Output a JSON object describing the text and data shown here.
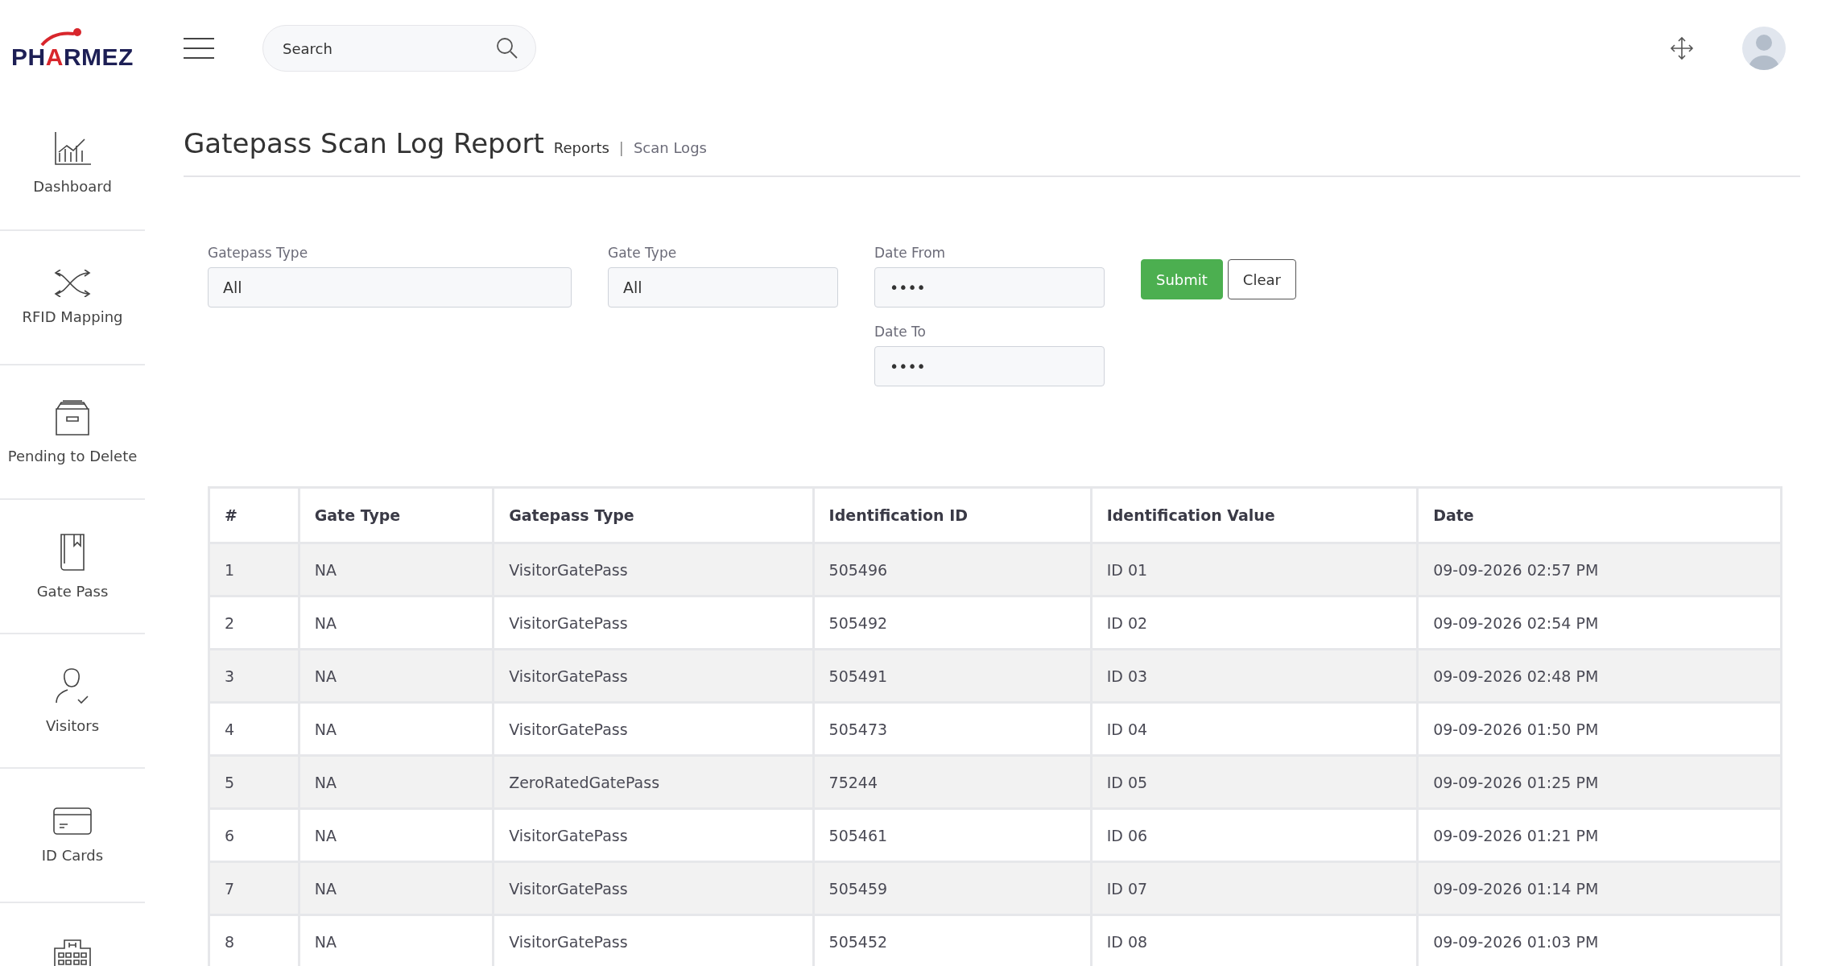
{
  "header": {
    "logo": "PHARMEZ",
    "search": {
      "placeholder": "Search"
    }
  },
  "sidebar": {
    "items": [
      {
        "label": "Dashboard",
        "selected": false
      },
      {
        "label": "RFID Mapping",
        "selected": false
      },
      {
        "label": "Pending to Delete",
        "selected": false
      },
      {
        "label": "Gate Pass",
        "selected": false
      },
      {
        "label": "Visitors",
        "selected": false
      },
      {
        "label": "ID Cards",
        "selected": false
      }
    ]
  },
  "page": {
    "title": "Gatepass Scan Log Report",
    "breadcrumbs": [
      "Reports",
      "Scan Logs"
    ],
    "separator": "|"
  },
  "filters": {
    "fields": [
      {
        "label": "Gatepass Type",
        "value": "All"
      },
      {
        "label": "Gate Type",
        "value": "All"
      },
      {
        "label": "Date From",
        "value": "••••"
      },
      {
        "label": "Date To",
        "value": "••••"
      }
    ],
    "buttons": [
      {
        "label": "Submit",
        "kind": "primary"
      },
      {
        "label": "Clear",
        "kind": "outline"
      }
    ]
  },
  "table": {
    "columns": [
      "#",
      "Gate Type",
      "Gatepass Type",
      "Identification ID",
      "Identification Value",
      "Date"
    ],
    "rows": [
      [
        "1",
        "NA",
        "VisitorGatePass",
        "505496",
        "ID 01",
        "09-09-2026 02:57 PM"
      ],
      [
        "2",
        "NA",
        "VisitorGatePass",
        "505492",
        "ID 02",
        "09-09-2026 02:54 PM"
      ],
      [
        "3",
        "NA",
        "VisitorGatePass",
        "505491",
        "ID 03",
        "09-09-2026 02:48 PM"
      ],
      [
        "4",
        "NA",
        "VisitorGatePass",
        "505473",
        "ID 04",
        "09-09-2026 01:50 PM"
      ],
      [
        "5",
        "NA",
        "ZeroRatedGatePass",
        "75244",
        "ID 05",
        "09-09-2026 01:25 PM"
      ],
      [
        "6",
        "NA",
        "VisitorGatePass",
        "505461",
        "ID 06",
        "09-09-2026 01:21 PM"
      ],
      [
        "7",
        "NA",
        "VisitorGatePass",
        "505459",
        "ID 07",
        "09-09-2026 01:14 PM"
      ],
      [
        "8",
        "NA",
        "VisitorGatePass",
        "505452",
        "ID 08",
        "09-09-2026 01:03 PM"
      ]
    ]
  }
}
